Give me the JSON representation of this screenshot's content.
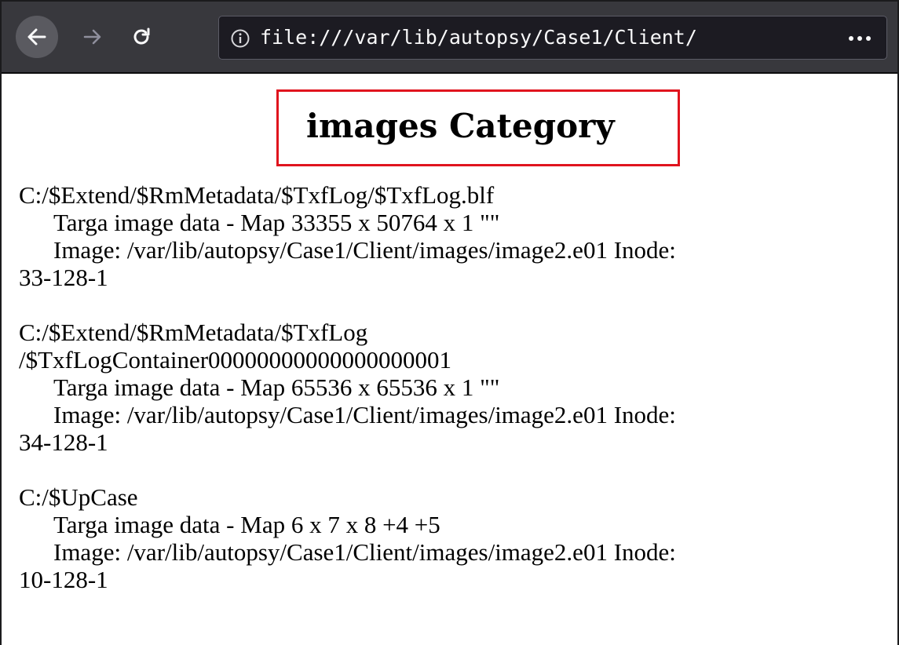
{
  "browser": {
    "url": "file:///var/lib/autopsy/Case1/Client/",
    "icons": {
      "back": "arrow-left-icon",
      "forward": "arrow-right-icon",
      "reload": "reload-icon",
      "info": "info-icon",
      "more": "more-dots-icon"
    }
  },
  "page": {
    "title": "images Category",
    "title_highlight_color": "#e0141e",
    "entries": [
      {
        "path_lines": [
          "C:/$Extend/$RmMetadata/$TxfLog/$TxfLog.blf"
        ],
        "type": "Targa image data - Map 33355 x 50764 x 1 \"\"",
        "image": "Image: /var/lib/autopsy/Case1/Client/images/image2.e01 Inode:",
        "inode": "33-128-1"
      },
      {
        "path_lines": [
          "C:/$Extend/$RmMetadata/$TxfLog",
          "/$TxfLogContainer00000000000000000001"
        ],
        "type": "Targa image data - Map 65536 x 65536 x 1 \"\"",
        "image": "Image: /var/lib/autopsy/Case1/Client/images/image2.e01 Inode:",
        "inode": "34-128-1"
      },
      {
        "path_lines": [
          "C:/$UpCase"
        ],
        "type": "Targa image data - Map 6 x 7 x 8 +4 +5",
        "image": "Image: /var/lib/autopsy/Case1/Client/images/image2.e01 Inode:",
        "inode": "10-128-1"
      }
    ]
  }
}
